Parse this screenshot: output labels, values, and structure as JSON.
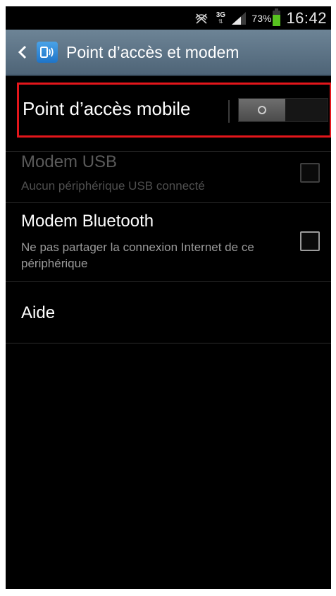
{
  "status_bar": {
    "icons": [
      "no-signal-icon",
      "network-3g-icon",
      "signal-strength-icon",
      "battery-icon"
    ],
    "network_type": "3G",
    "battery_percent": "73%",
    "battery_level": 0.73,
    "time": "16:42"
  },
  "title_bar": {
    "back_icon": "chevron-left-icon",
    "app_icon": "hotspot-icon",
    "title": "Point d’accès et modem"
  },
  "settings": {
    "hotspot": {
      "label": "Point d’accès mobile",
      "enabled": false,
      "highlight_color": "#e3161b"
    },
    "usb_modem": {
      "title": "Modem USB",
      "subtitle": "Aucun périphérique USB connecté",
      "checked": false,
      "disabled": true
    },
    "bluetooth_modem": {
      "title": "Modem Bluetooth",
      "subtitle": "Ne pas partager la connexion Internet de ce périphérique",
      "checked": false,
      "disabled": false
    },
    "help": {
      "title": "Aide"
    }
  },
  "colors": {
    "title_bar": "#5b7183",
    "background": "#000000",
    "battery": "#57c21f"
  }
}
